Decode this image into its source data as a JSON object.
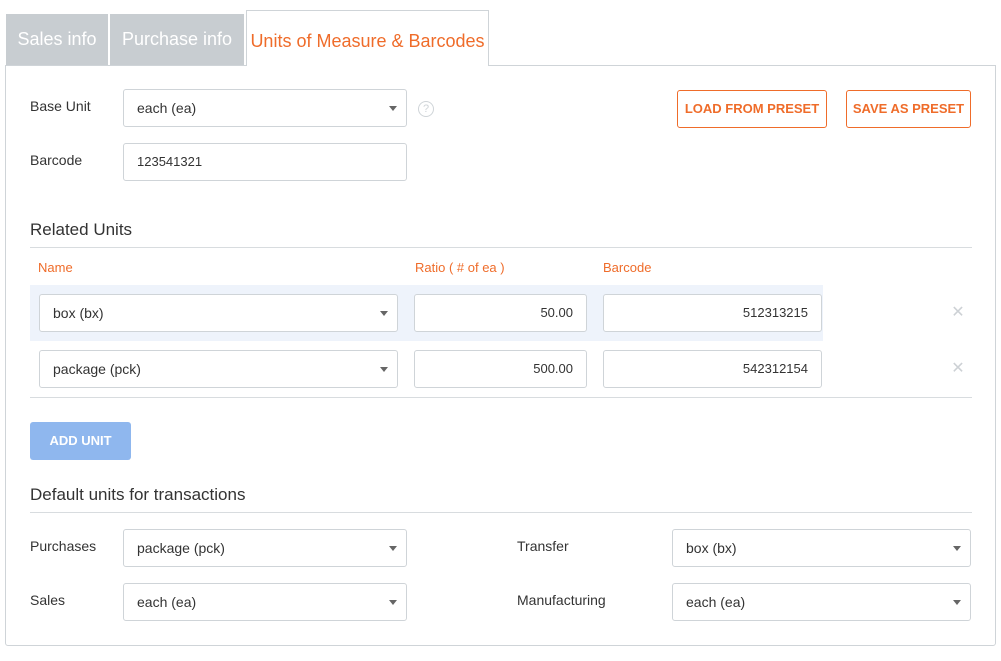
{
  "tabs": [
    {
      "label": "Sales info"
    },
    {
      "label": "Purchase info"
    },
    {
      "label": "Units of Measure & Barcodes"
    }
  ],
  "base": {
    "base_unit_label": "Base Unit",
    "base_unit_value": "each (ea)",
    "barcode_label": "Barcode",
    "barcode_value": "123541321",
    "help_glyph": "?"
  },
  "buttons": {
    "load_preset": "LOAD FROM PRESET",
    "save_preset": "SAVE AS PRESET",
    "add_unit": "ADD UNIT"
  },
  "related": {
    "title": "Related Units",
    "columns": [
      "Name",
      "Ratio ( # of ea )",
      "Barcode"
    ],
    "rows": [
      {
        "name": "box (bx)",
        "ratio": "50.00",
        "barcode": "512313215"
      },
      {
        "name": "package (pck)",
        "ratio": "500.00",
        "barcode": "542312154"
      }
    ]
  },
  "defaults": {
    "title": "Default units for transactions",
    "purchases_label": "Purchases",
    "purchases_value": "package (pck)",
    "sales_label": "Sales",
    "sales_value": "each (ea)",
    "transfer_label": "Transfer",
    "transfer_value": "box (bx)",
    "manufacturing_label": "Manufacturing",
    "manufacturing_value": "each (ea)"
  },
  "colors": {
    "accent": "#ef6c2a",
    "tab_inactive": "#c8cdd1",
    "add_button": "#8fb7ee",
    "row_highlight": "#eef3fb"
  },
  "icons": {
    "remove": "close-icon",
    "dropdown": "chevron-down-icon",
    "help": "help-icon"
  }
}
